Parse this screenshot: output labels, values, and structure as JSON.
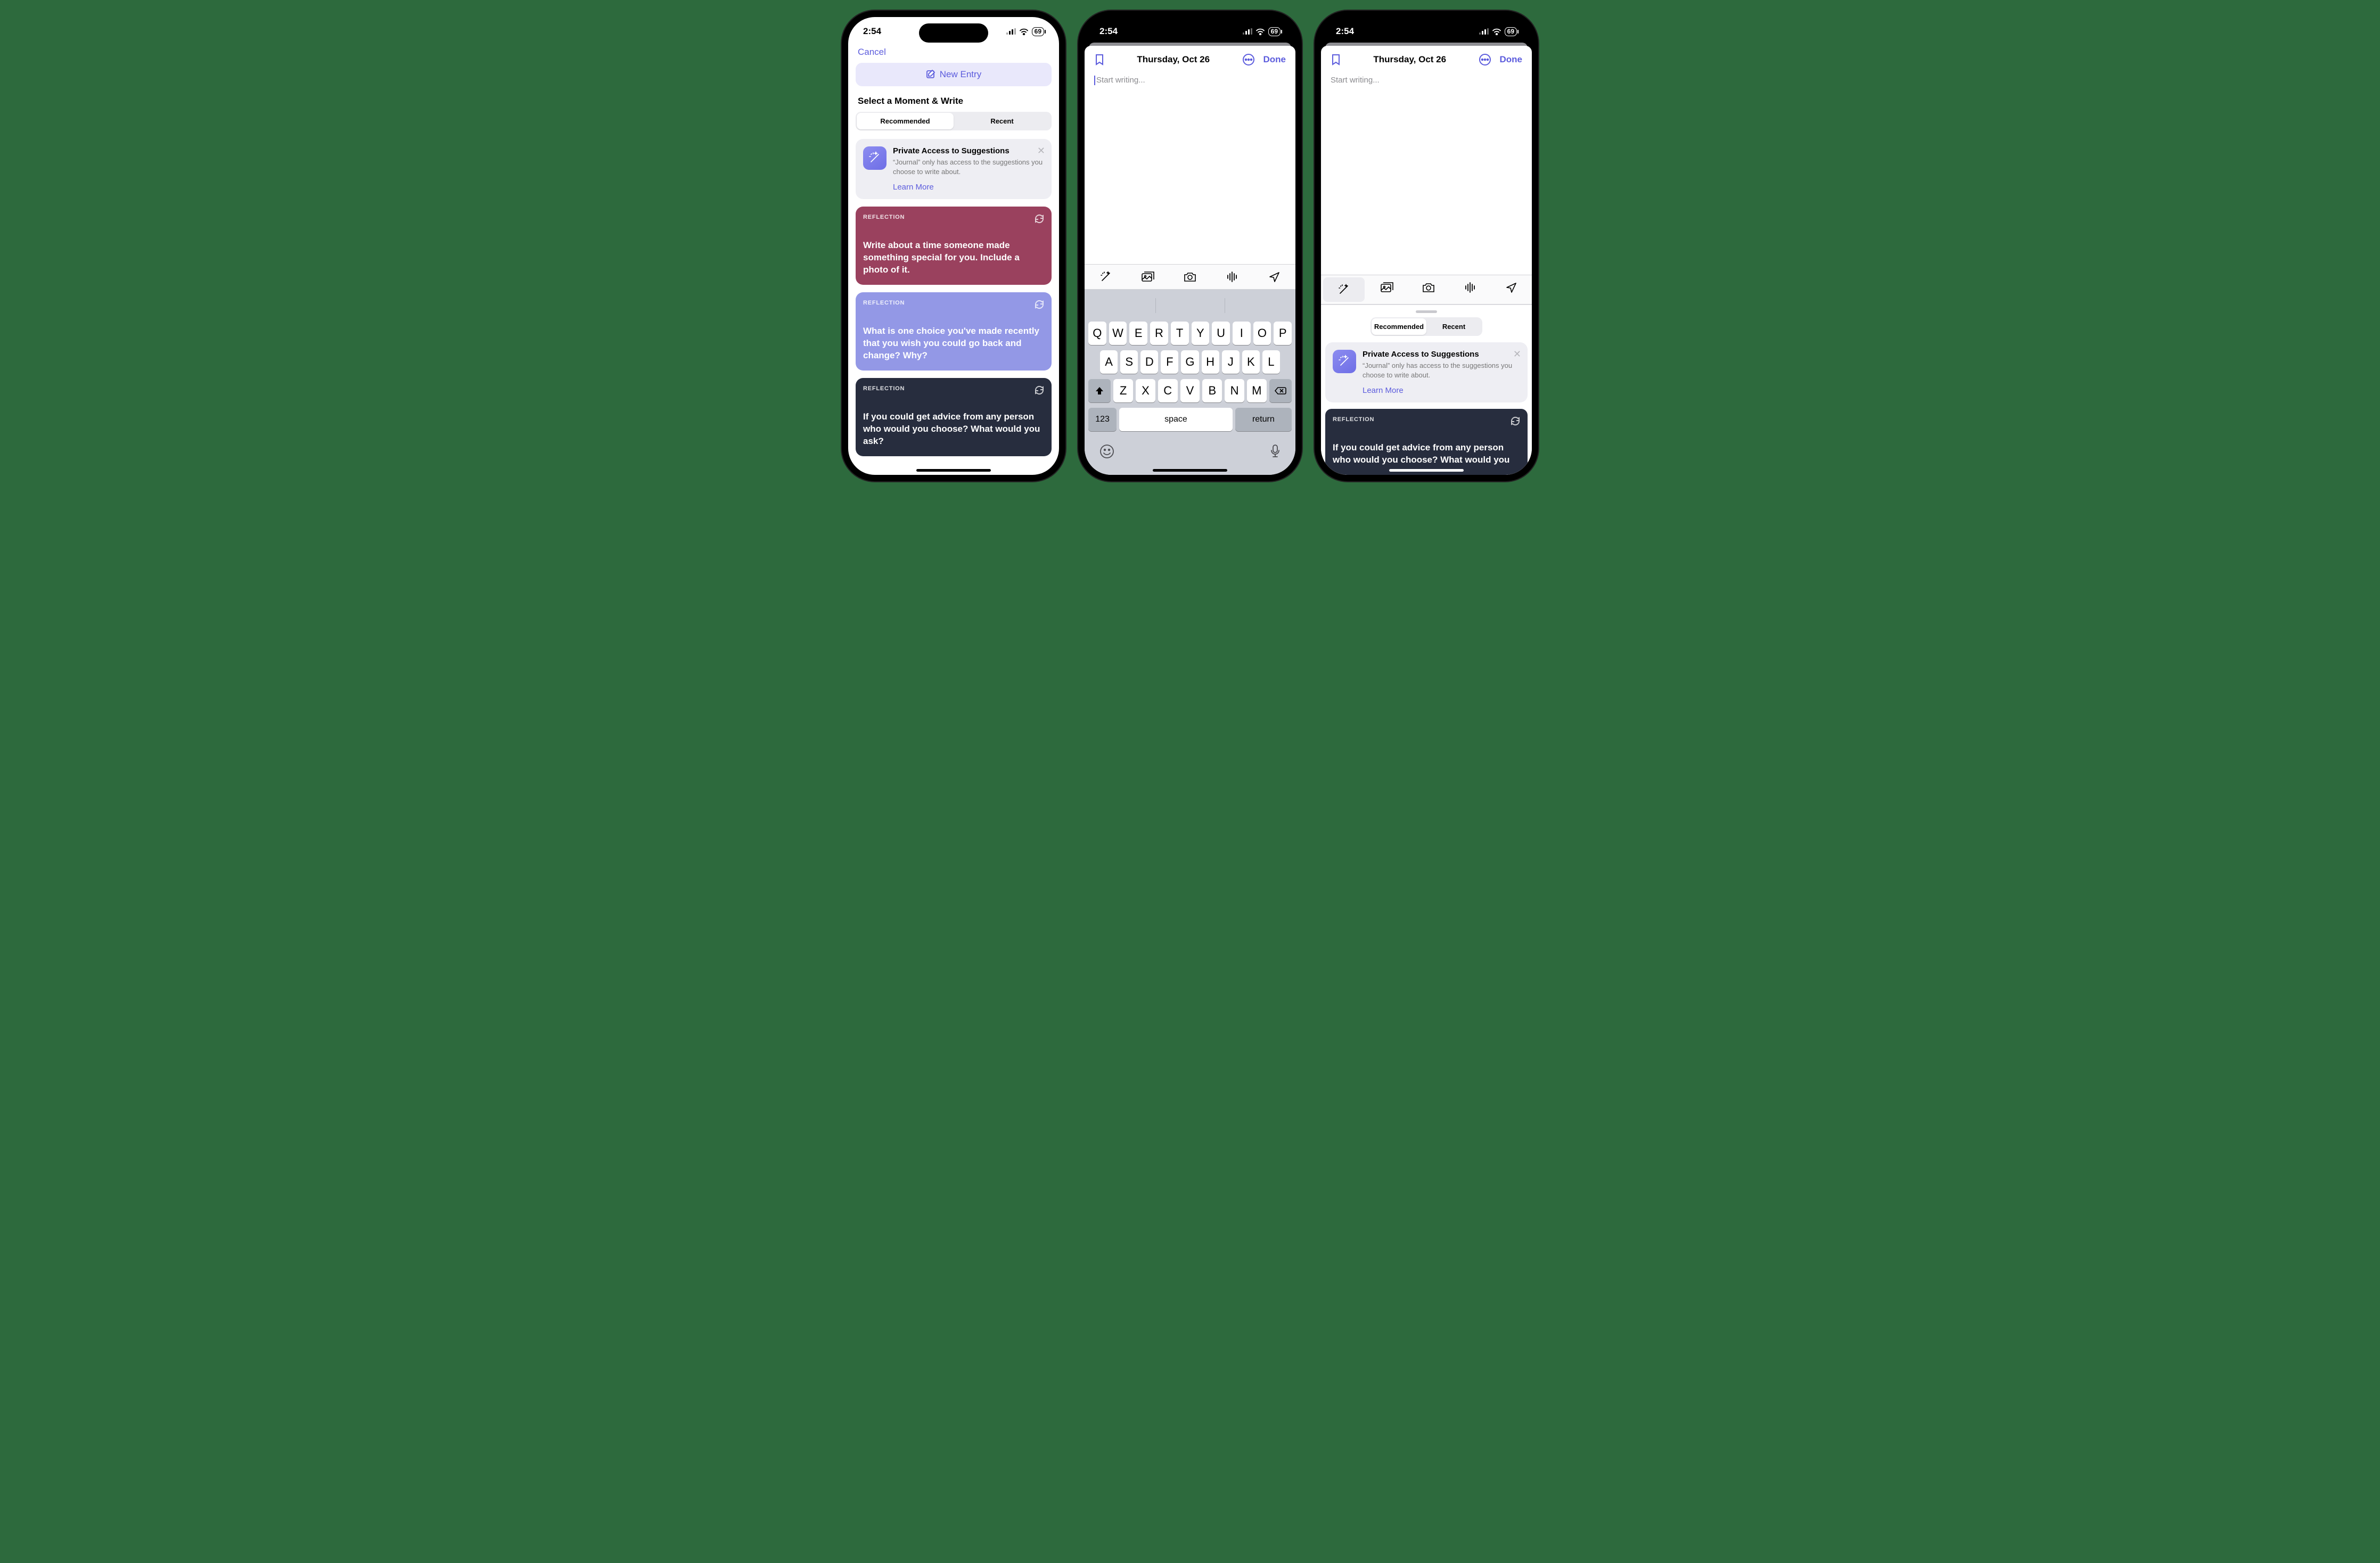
{
  "status": {
    "time": "2:54",
    "battery": "69"
  },
  "phone1": {
    "cancel": "Cancel",
    "new_entry": "New Entry",
    "section_title": "Select a Moment & Write",
    "seg": {
      "recommended": "Recommended",
      "recent": "Recent"
    },
    "info": {
      "title": "Private Access to Suggestions",
      "body": "“Journal” only has access to the suggestions you choose to write about.",
      "learn_more": "Learn More"
    },
    "cards": [
      {
        "tag": "REFLECTION",
        "body": "Write about a time someone made something special for you. Include a photo of it."
      },
      {
        "tag": "REFLECTION",
        "body": "What is one choice you've made recently that you wish you could go back and change? Why?"
      },
      {
        "tag": "REFLECTION",
        "body": "If you could get advice from any person who would you choose? What would you ask?"
      }
    ]
  },
  "entry": {
    "date": "Thursday, Oct 26",
    "done": "Done",
    "placeholder": "Start writing..."
  },
  "keyboard": {
    "row1": [
      "Q",
      "W",
      "E",
      "R",
      "T",
      "Y",
      "U",
      "I",
      "O",
      "P"
    ],
    "row2": [
      "A",
      "S",
      "D",
      "F",
      "G",
      "H",
      "J",
      "K",
      "L"
    ],
    "row3": [
      "Z",
      "X",
      "C",
      "V",
      "B",
      "N",
      "M"
    ],
    "k123": "123",
    "space": "space",
    "ret": "return"
  },
  "phone3": {
    "seg": {
      "recommended": "Recommended",
      "recent": "Recent"
    },
    "info": {
      "title": "Private Access to Suggestions",
      "body": "“Journal” only has access to the suggestions you choose to write about.",
      "learn_more": "Learn More"
    },
    "card": {
      "tag": "REFLECTION",
      "body": "If you could get advice from any person who would you choose? What would you"
    }
  }
}
